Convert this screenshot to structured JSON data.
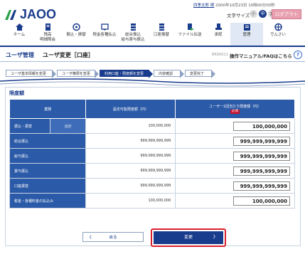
{
  "header": {
    "logo_text": "JAOO",
    "user_line_name": "四季太郎 様",
    "user_line_rest": "2000年10月23日 10時00分00秒",
    "font_size_label": "文字サイズ",
    "font_small": "小",
    "font_medium": "中",
    "font_large": "大",
    "logout_label": "ログアウト",
    "nav": [
      {
        "label": "ホーム",
        "icon": "home-icon"
      },
      {
        "label": "残高\n明細照会",
        "icon": "statement-icon"
      },
      {
        "label": "振込・振替",
        "icon": "transfer-icon"
      },
      {
        "label": "税金各種払込",
        "icon": "tax-payment-icon"
      },
      {
        "label": "総合振込\n給与賞与振込",
        "icon": "bulk-transfer-icon"
      },
      {
        "label": "口座振替",
        "icon": "account-debit-icon"
      },
      {
        "label": "ファイル伝送",
        "icon": "file-transfer-icon"
      },
      {
        "label": "承認",
        "icon": "approval-icon"
      },
      {
        "label": "管理",
        "icon": "management-icon"
      },
      {
        "label": "でんさい",
        "icon": "densai-icon"
      }
    ]
  },
  "page": {
    "section": "ユーザ管理",
    "title": "ユーザ変更［口座］",
    "screen_code": "BRSK011",
    "manual_link": "操作マニュアル/FAQはこちら",
    "help_symbol": "?"
  },
  "steps": [
    {
      "label": "ユーザ基本情報を変更"
    },
    {
      "label": "ユーザ権限を変更"
    },
    {
      "label": "利用口座・限度額を変更"
    },
    {
      "label": "内容確認"
    },
    {
      "label": "変更完了"
    }
  ],
  "limits": {
    "title": "限度額",
    "col_type": "業務",
    "col_configurable": "設定可能限度額（円）",
    "col_user_limit": "ユーザー1回当たり限度額（円）",
    "required_badge": "必須",
    "rows": [
      {
        "label": "振込・振替",
        "sub": "合計",
        "configurable": "100,000,000",
        "value": "100,000,000"
      },
      {
        "label": "総合振込",
        "sub": "",
        "configurable": "999,999,999,999",
        "value": "999,999,999,999"
      },
      {
        "label": "給与振込",
        "sub": "",
        "configurable": "999,999,999,999",
        "value": "999,999,999,999"
      },
      {
        "label": "賞与振込",
        "sub": "",
        "configurable": "999,999,999,999",
        "value": "999,999,999,999"
      },
      {
        "label": "口座振替",
        "sub": "",
        "configurable": "999,999,999,999",
        "value": "999,999,999,999"
      },
      {
        "label": "税金・各種料金の払込み",
        "sub": "",
        "configurable": "100,000,000",
        "value": "100,000,000"
      }
    ]
  },
  "buttons": {
    "back_label": "戻る",
    "back_arrow": "〈",
    "next_label": "変更",
    "next_arrow": "〉"
  },
  "colors": {
    "brand": "#1a3c8c",
    "table_header": "#2b5aa8",
    "highlight_red": "#d8202c",
    "required_red": "#c8102e"
  }
}
